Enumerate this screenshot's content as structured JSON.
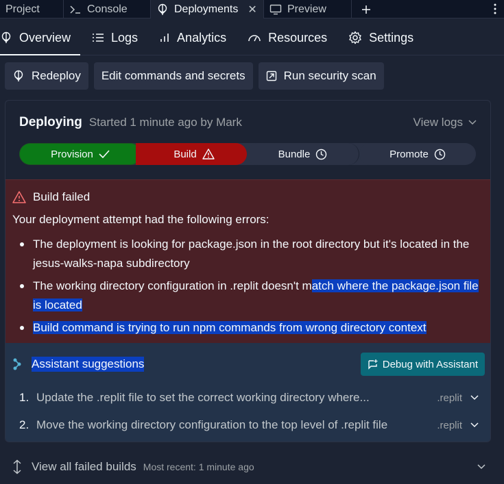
{
  "tabs": [
    {
      "label": "Project"
    },
    {
      "label": "Console"
    },
    {
      "label": "Deployments"
    },
    {
      "label": "Preview"
    }
  ],
  "subnav": [
    "Overview",
    "Logs",
    "Analytics",
    "Resources",
    "Settings"
  ],
  "actions": {
    "redeploy": "Redeploy",
    "edit": "Edit commands and secrets",
    "scan": "Run security scan"
  },
  "deploy": {
    "title": "Deploying",
    "subtitle": "Started 1 minute ago by Mark",
    "view_logs": "View logs",
    "steps": [
      "Provision",
      "Build",
      "Bundle",
      "Promote"
    ]
  },
  "error": {
    "title": "Build failed",
    "intro": "Your deployment attempt had the following errors:",
    "items": [
      {
        "a": "The deployment is looking for package.json in the root directory but it's located in the jesus-walks-napa subdirectory",
        "b": ""
      },
      {
        "a": "The working directory configuration in .replit doesn't m",
        "b": "atch where the package.json file is located"
      },
      {
        "a": "",
        "b": "Build command is trying to run npm commands from wrong directory context"
      }
    ]
  },
  "assistant": {
    "title": "Assistant suggestions",
    "debug_label": "Debug with Assistant",
    "suggestions": [
      {
        "num": "1.",
        "text": "Update the .replit file to set the correct working directory where...",
        "file": ".replit"
      },
      {
        "num": "2.",
        "text": "Move the working directory configuration to the top level of .replit file",
        "file": ".replit"
      }
    ]
  },
  "footer": {
    "label": "View all failed builds",
    "recent": "Most recent: 1 minute ago"
  },
  "colors": {
    "bg": "#1c2333",
    "success": "#0b7a17",
    "error": "#a60d0d",
    "error_panel": "#4a2026",
    "assistant_panel": "#23334a",
    "highlight": "#0b3fbf",
    "debug_button": "#0b6a7a"
  }
}
